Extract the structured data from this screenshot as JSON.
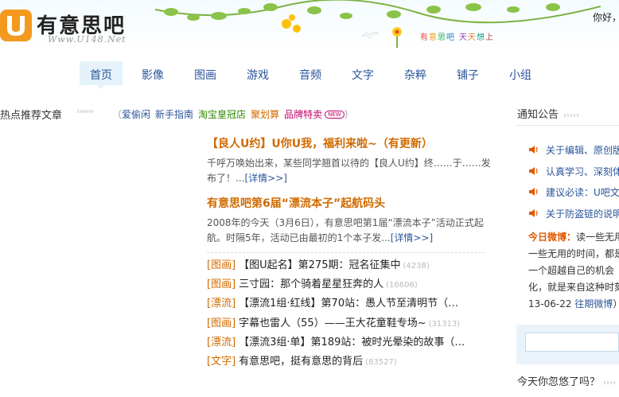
{
  "header": {
    "logo_text": "有意思吧",
    "logo_url": "Www.U148.Net",
    "greeting": "你好，",
    "slogan": [
      "有",
      "意",
      "思",
      "吧",
      "天",
      "天",
      "想",
      "上"
    ],
    "slogan_colors": [
      "#e74c3c",
      "#f39c12",
      "#27ae60",
      "#2980b9",
      "#8e44ad",
      "#e67e22",
      "#16a085",
      "#c0392b"
    ]
  },
  "nav": {
    "items": [
      {
        "label": "首页",
        "active": true
      },
      {
        "label": "影像"
      },
      {
        "label": "图画"
      },
      {
        "label": "游戏"
      },
      {
        "label": "音频"
      },
      {
        "label": "文字"
      },
      {
        "label": "杂粹"
      },
      {
        "label": "铺子"
      },
      {
        "label": "小组"
      }
    ]
  },
  "hotbar": {
    "title": "热点推荐文章",
    "arrows": "›››››››",
    "open_paren": "（",
    "close_paren": "）",
    "links": [
      {
        "label": "爱偷闲",
        "color": "#2a5599"
      },
      {
        "label": "新手指南",
        "color": "#2a5599"
      },
      {
        "label": "淘宝皇冠店",
        "color": "#2e8b00"
      },
      {
        "label": "聚划算",
        "color": "#d06a00"
      },
      {
        "label": "品牌特卖",
        "color": "#c4006b"
      }
    ],
    "new_badge": "NEW"
  },
  "articles": [
    {
      "title": "【良人U约】U你U我，福利来啦~（有更新）",
      "summary": "千呼万唤始出来，某些同学翘首以待的【良人U约】终……于……发布了！...",
      "more": "[详情>>]"
    },
    {
      "title": "有意思吧第6届“漂流本子”起航码头",
      "summary": "2008年的今天（3月6日），有意思吧第1届“漂流本子”活动正式起航。时隔5年，活动已由最初的1个本子发...",
      "more": "[详情>>]"
    }
  ],
  "list": [
    {
      "cat": "[图画]",
      "title": "【图U起名】第275期：冠名征集中",
      "count": "(4238)"
    },
    {
      "cat": "[图画]",
      "title": "三寸园：那个骑着星星狂奔的人",
      "count": "(16606)"
    },
    {
      "cat": "[漂流]",
      "title": "【漂流1组·红线】第70站：愚人节至清明节（…",
      "count": ""
    },
    {
      "cat": "[图画]",
      "title": "字幕也雷人（55）——王大花童鞋专场~",
      "count": "(31313)"
    },
    {
      "cat": "[漂流]",
      "title": "【漂流3组·单】第189站：被时光晕染的故事（…",
      "count": ""
    },
    {
      "cat": "[文字]",
      "title": "有意思吧，挺有意思的背后",
      "count": "(83527)"
    }
  ],
  "right": {
    "notice_title": "通知公告",
    "notice_arrows": "›››››",
    "notices": [
      "关于编辑、原创版",
      "认真学习、深刻体",
      "建议必读：U吧文",
      "关于防盗链的说明"
    ],
    "weibo_label": "今日微博：",
    "weibo_lines": [
      "读一些无用",
      "一些无用的时间，都是",
      "一个超越自己的机会",
      "化，就是来自这种时刻"
    ],
    "weibo_date": "13-06-22",
    "weibo_link": "往期微博",
    "weibo_link_suffix": "）",
    "forget_title": "今天你忽悠了吗？",
    "forget_arrows": "››››"
  }
}
